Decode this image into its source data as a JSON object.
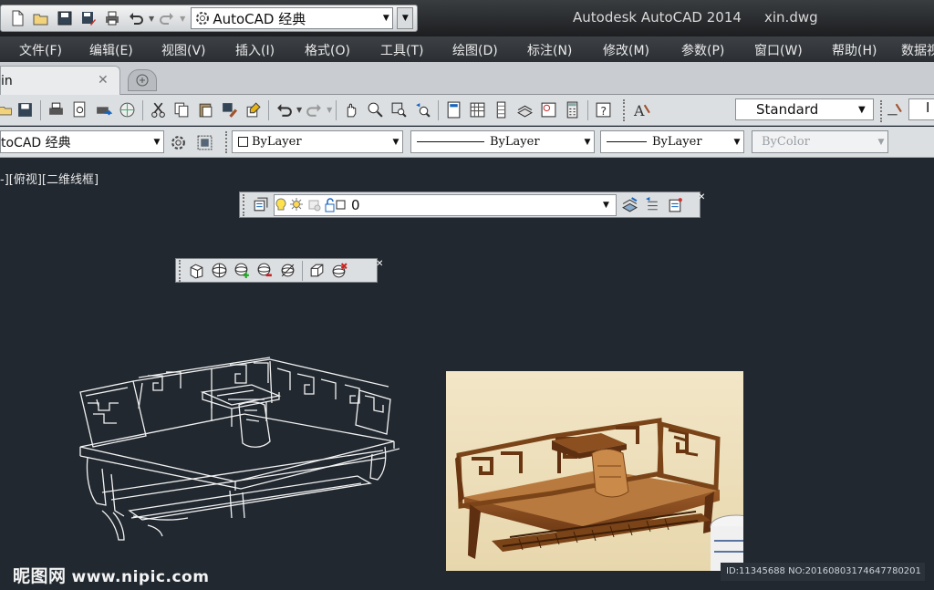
{
  "titlebar": {
    "workspace": "AutoCAD 经典",
    "app_title": "Autodesk AutoCAD 2014",
    "file_title": "xin.dwg"
  },
  "menu": [
    "文件(F)",
    "编辑(E)",
    "视图(V)",
    "插入(I)",
    "格式(O)",
    "工具(T)",
    "绘图(D)",
    "标注(N)",
    "修改(M)",
    "参数(P)",
    "窗口(W)",
    "帮助(H)",
    "数据视"
  ],
  "tabs": {
    "active": "in"
  },
  "toolbar1": {
    "text_style": "Standard",
    "extra_combo": "I"
  },
  "toolbar2": {
    "workspace": "toCAD 经典",
    "color": "ByLayer",
    "linetype": "ByLayer",
    "lineweight": "ByLayer",
    "plotstyle": "ByColor"
  },
  "viewport": {
    "label": "-][俯视][二维线框]"
  },
  "layers": {
    "current": "0"
  },
  "colors": {
    "drawing_bg": "#212830",
    "toolbar_bg": "#dcdfe2",
    "menubar_bg": "#35393d"
  },
  "watermark": {
    "chinese": "昵图网",
    "url": "www.nipic.com"
  },
  "image_id": "ID:11345688 NO:20160803174647780201"
}
